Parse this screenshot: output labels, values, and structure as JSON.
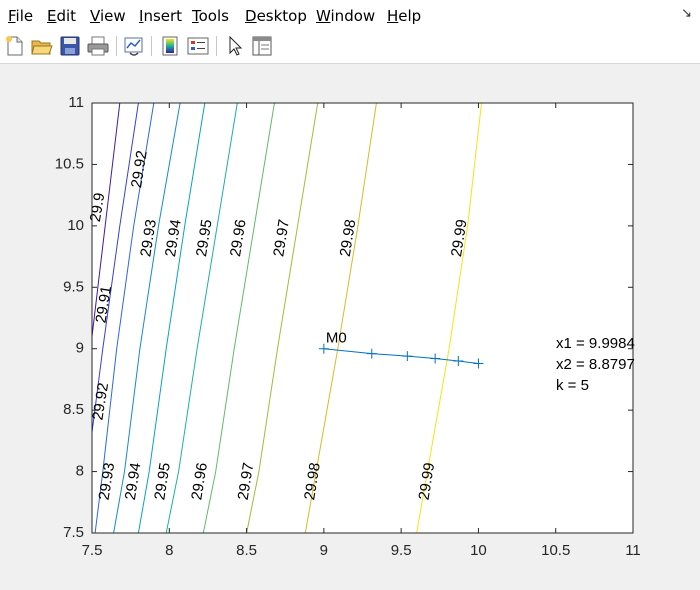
{
  "menu": {
    "items": [
      {
        "u": "F",
        "rest": "ile"
      },
      {
        "u": "E",
        "rest": "dit"
      },
      {
        "u": "V",
        "rest": "iew"
      },
      {
        "u": "I",
        "rest": "nsert"
      },
      {
        "u": "T",
        "rest": "ools"
      },
      {
        "u": "D",
        "rest": "esktop"
      },
      {
        "u": "W",
        "rest": "indow"
      },
      {
        "u": "H",
        "rest": "elp"
      }
    ],
    "dock_symbol": "↘"
  },
  "toolbar": {
    "icons": [
      "new-figure-icon",
      "open-file-icon",
      "save-icon",
      "print-icon",
      "link-plot-icon",
      "colorbar-icon",
      "legend-icon",
      "edit-pointer-icon",
      "property-inspector-icon"
    ]
  },
  "chart_data": {
    "type": "contour",
    "xlim": [
      7.5,
      11
    ],
    "ylim": [
      7.5,
      11
    ],
    "xticks": [
      "7.5",
      "8",
      "8.5",
      "9",
      "9.5",
      "10",
      "10.5",
      "11"
    ],
    "yticks": [
      "7.5",
      "8",
      "8.5",
      "9",
      "9.5",
      "10",
      "10.5",
      "11"
    ],
    "contours": [
      {
        "level": "29.9",
        "color": "#3f1aa6",
        "points": [
          [
            7.5,
            9.1
          ],
          [
            7.68,
            11
          ]
        ]
      },
      {
        "level": "29.91",
        "color": "#3a3dd9",
        "points": [
          [
            7.5,
            8.32
          ],
          [
            7.57,
            9.0
          ],
          [
            7.68,
            10.0
          ],
          [
            7.8,
            11
          ]
        ]
      },
      {
        "level": "29.92",
        "color": "#2a67e6",
        "points": [
          [
            7.52,
            7.5
          ],
          [
            7.57,
            8.0
          ],
          [
            7.66,
            9.0
          ],
          [
            7.77,
            10.0
          ],
          [
            7.9,
            11
          ]
        ]
      },
      {
        "level": "29.93",
        "color": "#1588d4",
        "points": [
          [
            7.64,
            7.5
          ],
          [
            7.71,
            8.0
          ],
          [
            7.81,
            9.0
          ],
          [
            7.93,
            10.0
          ],
          [
            8.07,
            11
          ]
        ]
      },
      {
        "level": "29.94",
        "color": "#06a2c2",
        "points": [
          [
            7.8,
            7.5
          ],
          [
            7.87,
            8.0
          ],
          [
            7.98,
            9.0
          ],
          [
            8.1,
            10.0
          ],
          [
            8.23,
            11
          ]
        ]
      },
      {
        "level": "29.95",
        "color": "#1cb29a",
        "points": [
          [
            7.98,
            7.5
          ],
          [
            8.06,
            8.0
          ],
          [
            8.18,
            9.0
          ],
          [
            8.31,
            10.0
          ],
          [
            8.44,
            11
          ]
        ]
      },
      {
        "level": "29.96",
        "color": "#5fba6e",
        "points": [
          [
            8.22,
            7.5
          ],
          [
            8.3,
            8.0
          ],
          [
            8.42,
            9.0
          ],
          [
            8.55,
            10.0
          ],
          [
            8.68,
            11
          ]
        ]
      },
      {
        "level": "29.97",
        "color": "#a5bb36",
        "points": [
          [
            8.5,
            7.5
          ],
          [
            8.58,
            8.0
          ],
          [
            8.7,
            9.0
          ],
          [
            8.83,
            10.0
          ],
          [
            8.96,
            11
          ]
        ]
      },
      {
        "level": "29.98",
        "color": "#d9ba27",
        "points": [
          [
            8.88,
            7.5
          ],
          [
            8.95,
            8.0
          ],
          [
            9.09,
            9.0
          ],
          [
            9.22,
            10.0
          ],
          [
            9.34,
            11
          ]
        ]
      },
      {
        "level": "29.99",
        "color": "#f3e513",
        "points": [
          [
            9.6,
            7.5
          ],
          [
            9.67,
            8.0
          ],
          [
            9.81,
            9.0
          ],
          [
            9.93,
            10.0
          ],
          [
            10.02,
            11
          ]
        ]
      }
    ],
    "labels": [
      {
        "text": "29.9",
        "x": 7.54,
        "y": 10.15,
        "color": "#000000"
      },
      {
        "text": "29.92",
        "x": 7.81,
        "y": 10.46,
        "color": "#000000"
      },
      {
        "text": "29.91",
        "x": 7.58,
        "y": 9.36,
        "color": "#000000"
      },
      {
        "text": "29.93",
        "x": 7.87,
        "y": 9.9,
        "color": "#000000"
      },
      {
        "text": "29.94",
        "x": 8.03,
        "y": 9.9,
        "color": "#000000"
      },
      {
        "text": "29.95",
        "x": 8.23,
        "y": 9.9,
        "color": "#000000"
      },
      {
        "text": "29.96",
        "x": 8.45,
        "y": 9.9,
        "color": "#000000"
      },
      {
        "text": "29.97",
        "x": 8.73,
        "y": 9.9,
        "color": "#000000"
      },
      {
        "text": "29.98",
        "x": 9.16,
        "y": 9.9,
        "color": "#000000"
      },
      {
        "text": "29.99",
        "x": 9.88,
        "y": 9.9,
        "color": "#000000"
      },
      {
        "text": "29.92",
        "x": 7.56,
        "y": 8.57,
        "color": "#000000"
      },
      {
        "text": "29.93",
        "x": 7.6,
        "y": 7.92,
        "color": "#000000"
      },
      {
        "text": "29.94",
        "x": 7.77,
        "y": 7.92,
        "color": "#000000"
      },
      {
        "text": "29.95",
        "x": 7.96,
        "y": 7.92,
        "color": "#000000"
      },
      {
        "text": "29.96",
        "x": 8.2,
        "y": 7.92,
        "color": "#000000"
      },
      {
        "text": "29.97",
        "x": 8.5,
        "y": 7.92,
        "color": "#000000"
      },
      {
        "text": "29.98",
        "x": 8.93,
        "y": 7.92,
        "color": "#000000"
      },
      {
        "text": "29.99",
        "x": 9.67,
        "y": 7.92,
        "color": "#000000"
      }
    ],
    "path": {
      "color": "#0072bd",
      "marker": "+",
      "points": [
        [
          9.0,
          9.0
        ],
        [
          9.31,
          8.96
        ],
        [
          9.54,
          8.94
        ],
        [
          9.72,
          8.92
        ],
        [
          9.87,
          8.9
        ],
        [
          10.0,
          8.88
        ]
      ],
      "start_label": "M0"
    },
    "annotation": [
      "x1 = 9.9984",
      "x2 = 8.8797",
      "k = 5"
    ]
  }
}
